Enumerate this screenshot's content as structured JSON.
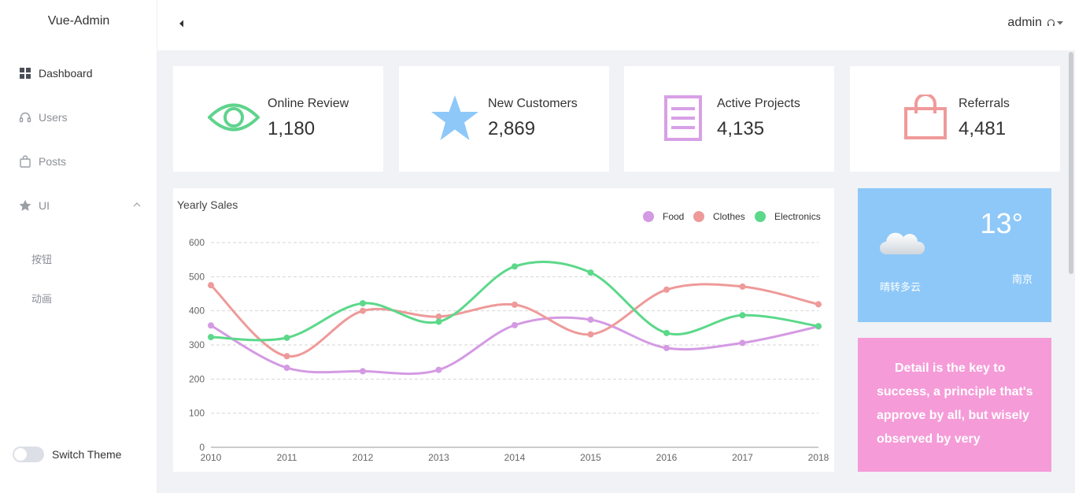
{
  "app": {
    "brand": "Vue-Admin"
  },
  "sidebar": {
    "items": [
      {
        "label": "Dashboard",
        "icon": "grid-icon"
      },
      {
        "label": "Users",
        "icon": "headset-icon"
      },
      {
        "label": "Posts",
        "icon": "bag-icon"
      },
      {
        "label": "UI",
        "icon": "star-icon"
      }
    ],
    "sub_items": [
      {
        "label": "按钮"
      },
      {
        "label": "动画"
      }
    ],
    "theme_label": "Switch Theme"
  },
  "header": {
    "username": "admin"
  },
  "cards": [
    {
      "title": "Online Review",
      "value": "1,180",
      "icon": "eye-icon",
      "color": "#5fd38d"
    },
    {
      "title": "New Customers",
      "value": "2,869",
      "icon": "star-icon",
      "color": "#8ec8f8"
    },
    {
      "title": "Active Projects",
      "value": "4,135",
      "icon": "document-icon",
      "color": "#d8a0e6"
    },
    {
      "title": "Referrals",
      "value": "4,481",
      "icon": "shopping-bag-icon",
      "color": "#f09a9a"
    }
  ],
  "weather": {
    "temp": "13°",
    "desc": "晴转多云",
    "city": "南京",
    "icon": "cloud-icon"
  },
  "quote": {
    "text": "Detail is the key to success, a principle that's approve by all, but wisely observed by very"
  },
  "colors": {
    "food": "#d49ae3",
    "clothes": "#ee9a9a",
    "electronics": "#5cd88a"
  },
  "chart_data": {
    "type": "line",
    "title": "Yearly Sales",
    "x": [
      "2010",
      "2011",
      "2012",
      "2013",
      "2014",
      "2015",
      "2016",
      "2017",
      "2018"
    ],
    "ylim": [
      0,
      600
    ],
    "yticks": [
      0,
      100,
      200,
      300,
      400,
      500,
      600
    ],
    "grid": true,
    "legend": "top-right",
    "series": [
      {
        "name": "Food",
        "values": [
          357,
          233,
          223,
          227,
          358,
          374,
          291,
          306,
          354
        ]
      },
      {
        "name": "Clothes",
        "values": [
          475,
          267,
          400,
          383,
          418,
          331,
          462,
          471,
          419
        ]
      },
      {
        "name": "Electronics",
        "values": [
          323,
          321,
          422,
          368,
          530,
          512,
          335,
          387,
          355
        ]
      }
    ]
  }
}
